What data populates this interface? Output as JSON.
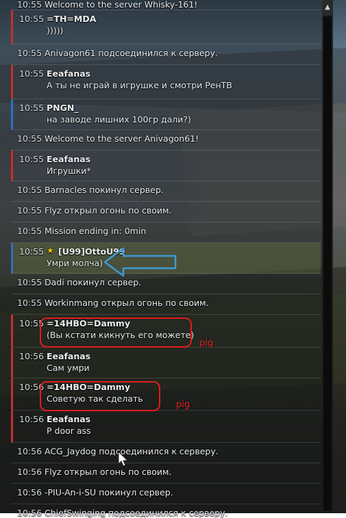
{
  "chat": {
    "messages": [
      {
        "time": "10:55",
        "text": "Welcome to the server Whisky-161!"
      },
      {
        "time": "10:55",
        "sender": "=TH=MDA",
        "text": ")))))"
      },
      {
        "time": "10:55",
        "text": "Anivagon61 подсоединился к серверу."
      },
      {
        "time": "10:55",
        "sender": "Eeafanas",
        "text": "А ты не играй в игрушке и смотри РенТВ"
      },
      {
        "time": "10:55",
        "sender": "PNGN_",
        "text": "на заводе лишних 100гр дали?)"
      },
      {
        "time": "10:55",
        "text": "Welcome to the server Anivagon61!"
      },
      {
        "time": "10:55",
        "sender": "Eeafanas",
        "text": "Игрушки*"
      },
      {
        "time": "10:55",
        "text": "Barnacles покинул сервер."
      },
      {
        "time": "10:55",
        "text": "Flyz открыл огонь по своим."
      },
      {
        "time": "10:55",
        "text": "Mission ending in: 0min"
      },
      {
        "time": "10:55",
        "sender": "[U99]OttoU99",
        "text": "Умри молча)"
      },
      {
        "time": "10:55",
        "text": "Dadi покинул сервер."
      },
      {
        "time": "10:55",
        "text": "Workinmang открыл огонь по своим."
      },
      {
        "time": "10:55",
        "sender": "=14HBO=Dammy",
        "text": "(Вы кстати кикнуть его можете)"
      },
      {
        "time": "10:56",
        "sender": "Eeafanas",
        "text": "Сам умри"
      },
      {
        "time": "10:56",
        "sender": "=14HBO=Dammy",
        "text": "Советую так сделать"
      },
      {
        "time": "10:56",
        "sender": "Eeafanas",
        "text": "P door ass"
      },
      {
        "time": "10:56",
        "text": "ACG_Jaydog подсоединился к серверу."
      },
      {
        "time": "10:56",
        "text": "Flyz открыл огонь по своим."
      },
      {
        "time": "10:56",
        "text": "-PIU-An-i-SU покинул сервер."
      },
      {
        "time": "10:56",
        "text": "ChiefSwinging подсоединился к серверу."
      }
    ]
  },
  "annotations": {
    "pig_label_1": "pig",
    "pig_label_2": "pig"
  },
  "colors": {
    "red_team_bar": "#c62f2f",
    "blue_team_bar": "#2f6fc6",
    "annotation_red": "#e21c1c",
    "annotation_blue": "#3a9bd9",
    "star": "#f2c200"
  },
  "icons": {
    "star": "star-icon",
    "scroll_up": "chevron-up-icon",
    "arrow": "arrow-left-icon",
    "cursor": "mouse-cursor-icon"
  }
}
